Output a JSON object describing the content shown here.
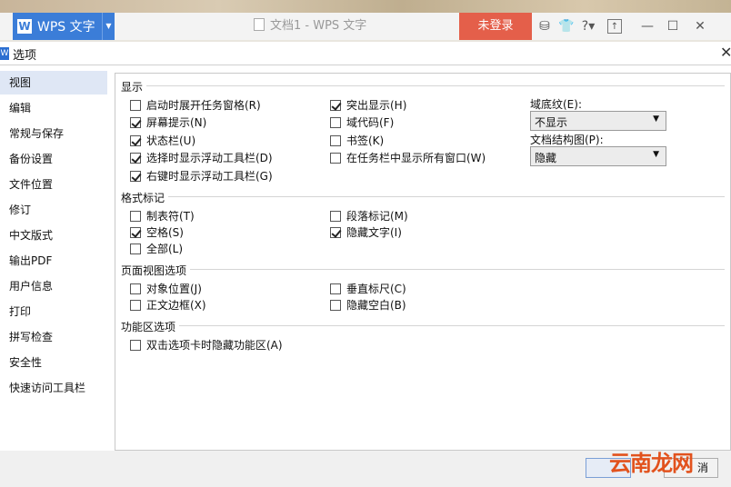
{
  "app": {
    "name": "WPS 文字",
    "logo": "W",
    "doc_title": "文档1 - WPS 文字",
    "login": "未登录",
    "icons": [
      "skin-icon",
      "shirt-icon",
      "help-icon",
      "upload-icon",
      "minimize-icon",
      "maximize-icon",
      "close-icon"
    ],
    "help_label": "?"
  },
  "dialog": {
    "title": "选项",
    "icon_letter": "W",
    "nav": [
      "视图",
      "编辑",
      "常规与保存",
      "备份设置",
      "文件位置",
      "修订",
      "中文版式",
      "输出PDF",
      "用户信息",
      "打印",
      "拼写检查",
      "安全性",
      "快速访问工具栏"
    ],
    "nav_selected": 0
  },
  "sections": {
    "display": {
      "title": "显示",
      "checks": [
        {
          "label": "启动时展开任务窗格(R)",
          "checked": false
        },
        {
          "label": "屏幕提示(N)",
          "checked": true
        },
        {
          "label": "状态栏(U)",
          "checked": true
        },
        {
          "label": "选择时显示浮动工具栏(D)",
          "checked": true
        },
        {
          "label": "右键时显示浮动工具栏(G)",
          "checked": true
        },
        {
          "label": "突出显示(H)",
          "checked": true
        },
        {
          "label": "域代码(F)",
          "checked": false
        },
        {
          "label": "书签(K)",
          "checked": false
        },
        {
          "label": "在任务栏中显示所有窗口(W)",
          "checked": false
        }
      ],
      "field_shading_label": "域底纹(E):",
      "field_shading_value": "不显示",
      "doc_map_label": "文档结构图(P):",
      "doc_map_value": "隐藏"
    },
    "format": {
      "title": "格式标记",
      "checks": [
        {
          "label": "制表符(T)",
          "checked": false
        },
        {
          "label": "空格(S)",
          "checked": true
        },
        {
          "label": "全部(L)",
          "checked": false
        },
        {
          "label": "段落标记(M)",
          "checked": false
        },
        {
          "label": "隐藏文字(I)",
          "checked": true
        }
      ]
    },
    "page_view": {
      "title": "页面视图选项",
      "checks": [
        {
          "label": "对象位置(J)",
          "checked": false
        },
        {
          "label": "正文边框(X)",
          "checked": false
        },
        {
          "label": "垂直标尺(C)",
          "checked": false
        },
        {
          "label": "隐藏空白(B)",
          "checked": false
        }
      ]
    },
    "ribbon": {
      "title": "功能区选项",
      "checks": [
        {
          "label": "双击选项卡时隐藏功能区(A)",
          "checked": false
        }
      ]
    }
  },
  "footer": {
    "cancel_label": "消"
  },
  "watermark": "云南龙网"
}
